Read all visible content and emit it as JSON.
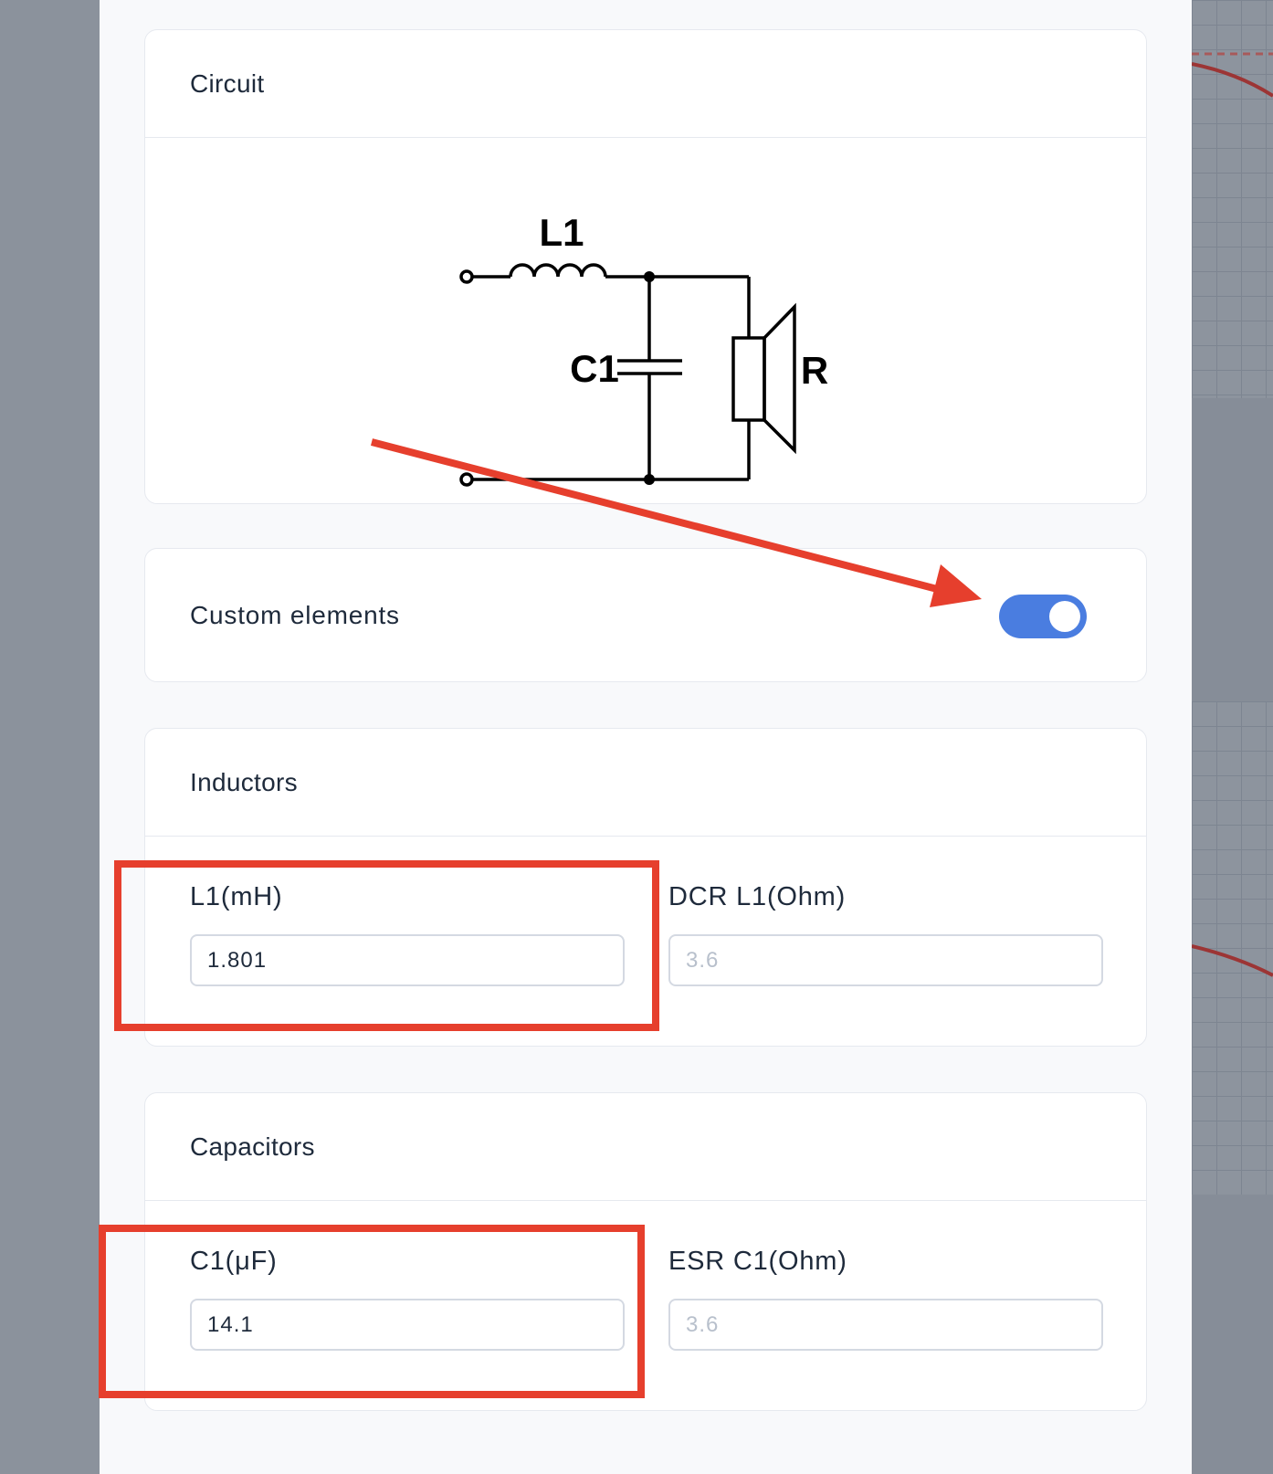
{
  "circuit": {
    "title": "Circuit",
    "labels": {
      "inductor": "L1",
      "capacitor": "C1",
      "resistor": "R"
    }
  },
  "custom_elements": {
    "label": "Custom elements",
    "enabled": true
  },
  "inductors": {
    "title": "Inductors",
    "l1_label": "L1(mH)",
    "l1_value": "1.801",
    "dcr_label": "DCR L1(Ohm)",
    "dcr_placeholder": "3.6"
  },
  "capacitors": {
    "title": "Capacitors",
    "c1_label": "C1(μF)",
    "c1_value": "14.1",
    "esr_label": "ESR C1(Ohm)",
    "esr_placeholder": "3.6"
  },
  "colors": {
    "accent": "#4a7de0",
    "annotation": "#e63f2d",
    "overlay": "#8b929c"
  }
}
